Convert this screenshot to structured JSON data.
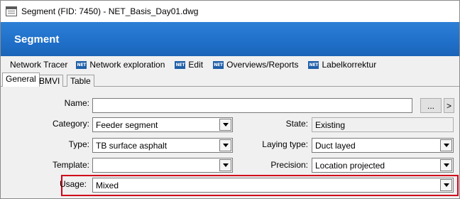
{
  "window": {
    "title": "Segment (FID: 7450) - NET_Basis_Day01.dwg"
  },
  "header": {
    "title": "Segment"
  },
  "toolbar": {
    "items": [
      {
        "label": "Network Tracer",
        "icon": "none"
      },
      {
        "label": "Network exploration",
        "icon": "net-icon"
      },
      {
        "label": "Edit",
        "icon": "net-icon"
      },
      {
        "label": "Overviews/Reports",
        "icon": "net-icon"
      },
      {
        "label": "Labelkorrektur",
        "icon": "net-icon"
      }
    ],
    "icon_text": "NET"
  },
  "tabs": [
    {
      "label": "General",
      "active": true
    },
    {
      "label": "BMVI",
      "active": false
    },
    {
      "label": "Table",
      "active": false
    }
  ],
  "form": {
    "name": {
      "label": "Name:",
      "value": "",
      "browse_label": "...",
      "next_label": ">"
    },
    "category": {
      "label": "Category:",
      "value": "Feeder segment"
    },
    "state": {
      "label": "State:",
      "value": "Existing"
    },
    "type": {
      "label": "Type:",
      "value": "TB surface asphalt"
    },
    "laying_type": {
      "label": "Laying type:",
      "value": "Duct layed"
    },
    "template": {
      "label": "Template:",
      "value": ""
    },
    "precision": {
      "label": "Precision:",
      "value": "Location projected"
    },
    "usage": {
      "label": "Usage:",
      "value": "Mixed"
    }
  },
  "colors": {
    "header_blue": "#1f6fc9",
    "highlight_red": "#d0021b",
    "net_icon_blue": "#1f5fa8"
  }
}
